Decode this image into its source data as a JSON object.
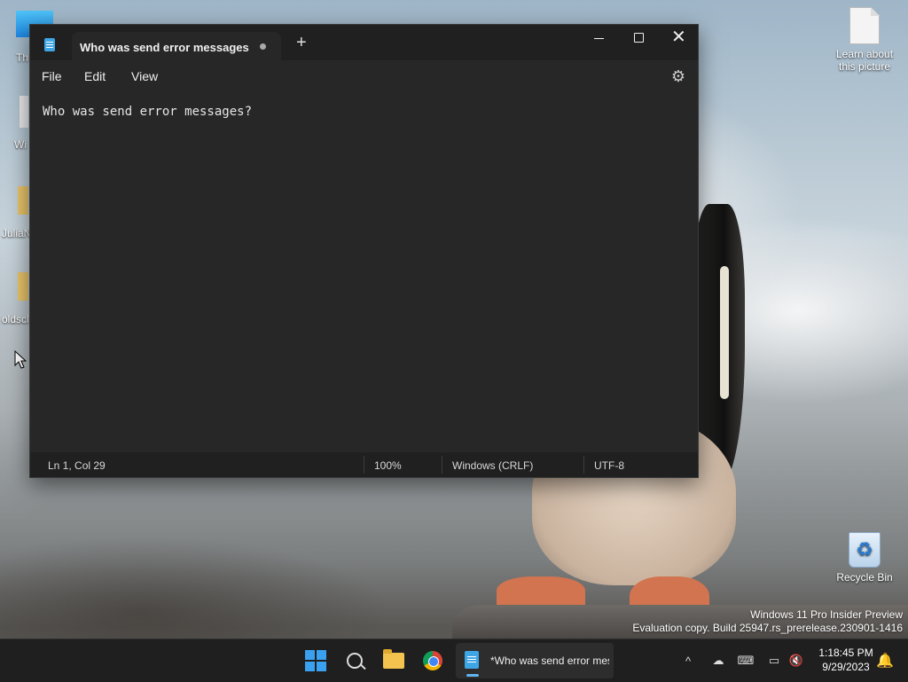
{
  "desktop": {
    "icons_right": [
      {
        "label": "Learn about this picture"
      },
      {
        "label": "Recycle Bin"
      }
    ],
    "icons_left_partial": [
      {
        "label": "Th"
      },
      {
        "label": "Wi"
      },
      {
        "label": "JuliaN"
      },
      {
        "label": "oldscl"
      }
    ],
    "watermark": {
      "line1": "Windows 11 Pro Insider Preview",
      "line2": "Evaluation copy. Build 25947.rs_prerelease.230901-1416"
    }
  },
  "window": {
    "tab_title": "Who was send error messages",
    "new_tab_symbol": "+",
    "controls": {
      "close_symbol": "✕"
    },
    "menu": {
      "file": "File",
      "edit": "Edit",
      "view": "View"
    },
    "settings_icon": "gear-icon",
    "editor_text": "Who was send error messages?",
    "status": {
      "position": "Ln 1, Col 29",
      "zoom": "100%",
      "line_ending": "Windows (CRLF)",
      "encoding": "UTF-8"
    }
  },
  "taskbar": {
    "notepad_label": "*Who was send error messages - Notepad",
    "time": "1:18:45 PM",
    "date": "9/29/2023",
    "tray_chevron": "^"
  }
}
